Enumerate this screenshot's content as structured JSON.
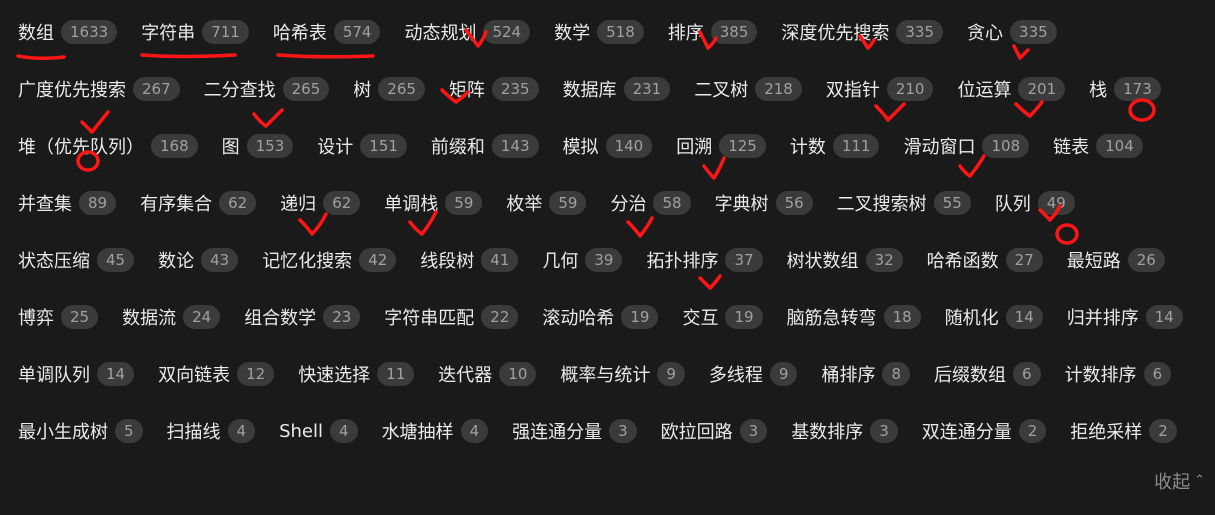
{
  "tags": [
    {
      "label": "数组",
      "count": "1633"
    },
    {
      "label": "字符串",
      "count": "711"
    },
    {
      "label": "哈希表",
      "count": "574"
    },
    {
      "label": "动态规划",
      "count": "524"
    },
    {
      "label": "数学",
      "count": "518"
    },
    {
      "label": "排序",
      "count": "385"
    },
    {
      "label": "深度优先搜索",
      "count": "335"
    },
    {
      "label": "贪心",
      "count": "335"
    },
    {
      "label": "广度优先搜索",
      "count": "267"
    },
    {
      "label": "二分查找",
      "count": "265"
    },
    {
      "label": "树",
      "count": "265"
    },
    {
      "label": "矩阵",
      "count": "235"
    },
    {
      "label": "数据库",
      "count": "231"
    },
    {
      "label": "二叉树",
      "count": "218"
    },
    {
      "label": "双指针",
      "count": "210"
    },
    {
      "label": "位运算",
      "count": "201"
    },
    {
      "label": "栈",
      "count": "173"
    },
    {
      "label": "堆（优先队列）",
      "count": "168"
    },
    {
      "label": "图",
      "count": "153"
    },
    {
      "label": "设计",
      "count": "151"
    },
    {
      "label": "前缀和",
      "count": "143"
    },
    {
      "label": "模拟",
      "count": "140"
    },
    {
      "label": "回溯",
      "count": "125"
    },
    {
      "label": "计数",
      "count": "111"
    },
    {
      "label": "滑动窗口",
      "count": "108"
    },
    {
      "label": "链表",
      "count": "104"
    },
    {
      "label": "并查集",
      "count": "89"
    },
    {
      "label": "有序集合",
      "count": "62"
    },
    {
      "label": "递归",
      "count": "62"
    },
    {
      "label": "单调栈",
      "count": "59"
    },
    {
      "label": "枚举",
      "count": "59"
    },
    {
      "label": "分治",
      "count": "58"
    },
    {
      "label": "字典树",
      "count": "56"
    },
    {
      "label": "二叉搜索树",
      "count": "55"
    },
    {
      "label": "队列",
      "count": "49"
    },
    {
      "label": "状态压缩",
      "count": "45"
    },
    {
      "label": "数论",
      "count": "43"
    },
    {
      "label": "记忆化搜索",
      "count": "42"
    },
    {
      "label": "线段树",
      "count": "41"
    },
    {
      "label": "几何",
      "count": "39"
    },
    {
      "label": "拓扑排序",
      "count": "37"
    },
    {
      "label": "树状数组",
      "count": "32"
    },
    {
      "label": "哈希函数",
      "count": "27"
    },
    {
      "label": "最短路",
      "count": "26"
    },
    {
      "label": "博弈",
      "count": "25"
    },
    {
      "label": "数据流",
      "count": "24"
    },
    {
      "label": "组合数学",
      "count": "23"
    },
    {
      "label": "字符串匹配",
      "count": "22"
    },
    {
      "label": "滚动哈希",
      "count": "19"
    },
    {
      "label": "交互",
      "count": "19"
    },
    {
      "label": "脑筋急转弯",
      "count": "18"
    },
    {
      "label": "随机化",
      "count": "14"
    },
    {
      "label": "归并排序",
      "count": "14"
    },
    {
      "label": "单调队列",
      "count": "14"
    },
    {
      "label": "双向链表",
      "count": "12"
    },
    {
      "label": "快速选择",
      "count": "11"
    },
    {
      "label": "迭代器",
      "count": "10"
    },
    {
      "label": "概率与统计",
      "count": "9"
    },
    {
      "label": "多线程",
      "count": "9"
    },
    {
      "label": "桶排序",
      "count": "8"
    },
    {
      "label": "后缀数组",
      "count": "6"
    },
    {
      "label": "计数排序",
      "count": "6"
    },
    {
      "label": "最小生成树",
      "count": "5"
    },
    {
      "label": "扫描线",
      "count": "4"
    },
    {
      "label": "Shell",
      "count": "4"
    },
    {
      "label": "水塘抽样",
      "count": "4"
    },
    {
      "label": "强连通分量",
      "count": "3"
    },
    {
      "label": "欧拉回路",
      "count": "3"
    },
    {
      "label": "基数排序",
      "count": "3"
    },
    {
      "label": "双连通分量",
      "count": "2"
    },
    {
      "label": "拒绝采样",
      "count": "2"
    }
  ],
  "collapse": {
    "label": "收起",
    "icon": "chevron-up-icon"
  },
  "colors": {
    "background": "#1a1a1a",
    "badge": "#3b3b3b",
    "annotation": "#ff1515"
  }
}
